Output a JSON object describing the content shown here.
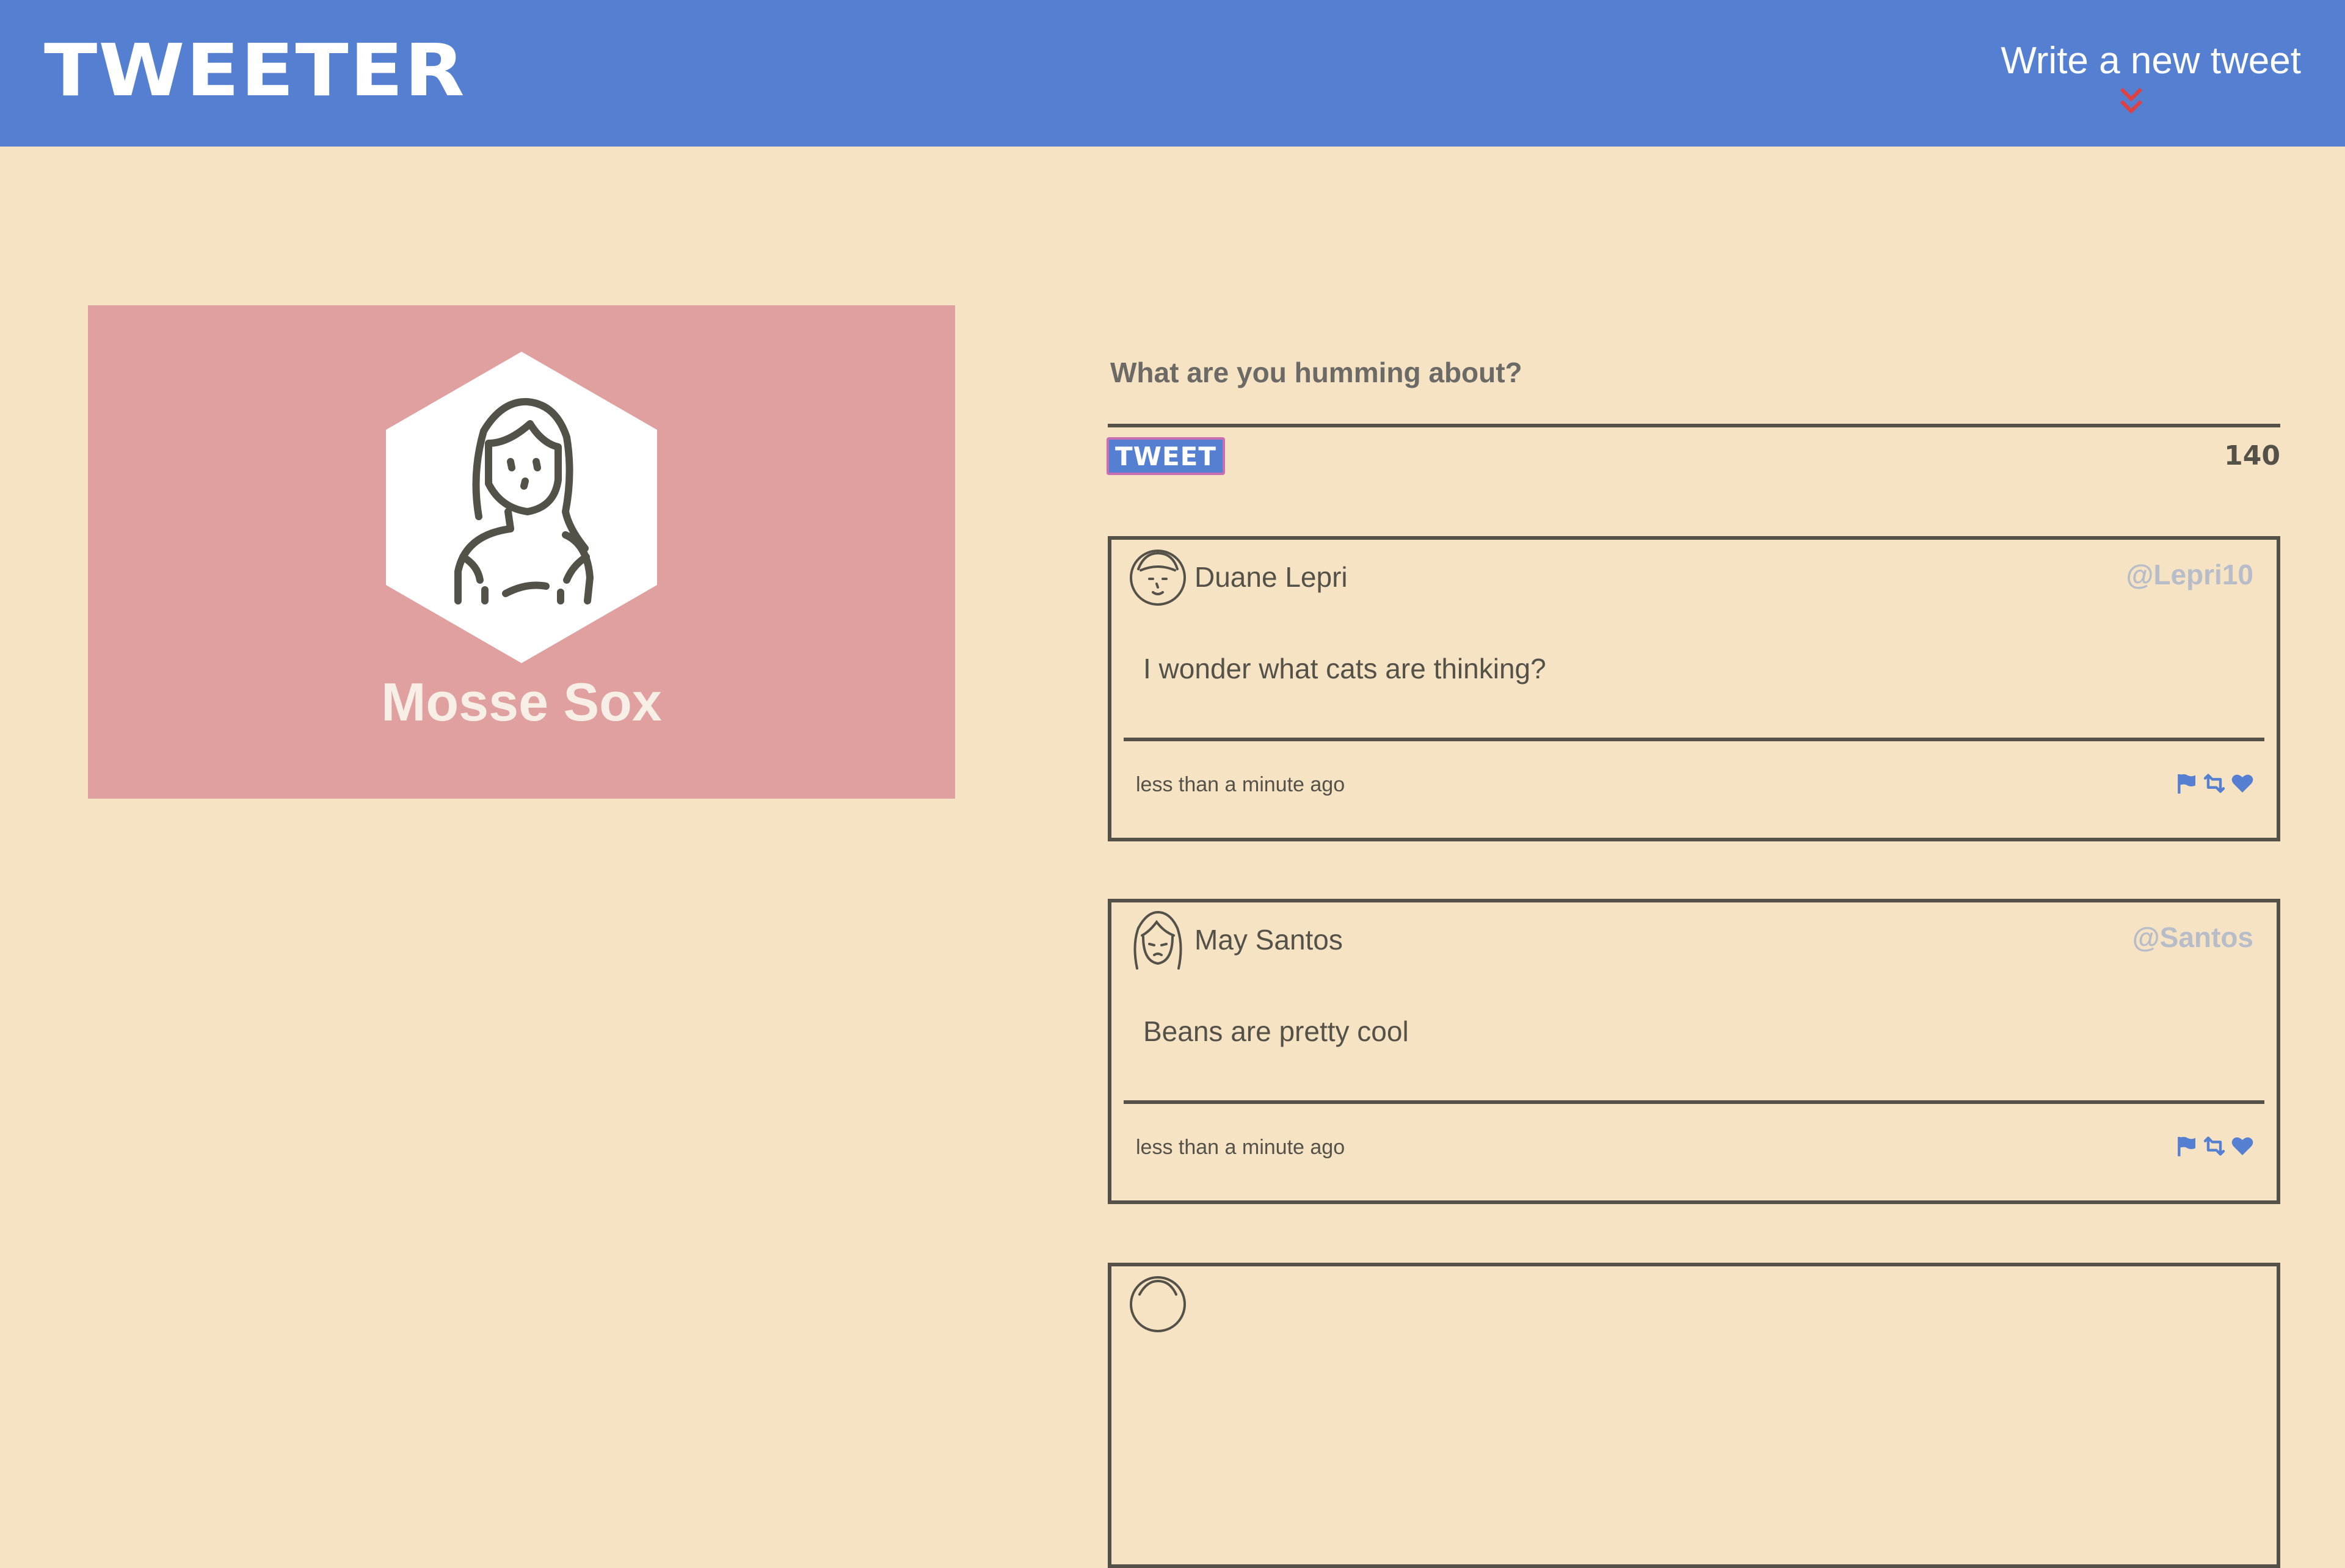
{
  "nav": {
    "brand": "TWEETER",
    "compose_toggle": "Write a new tweet",
    "compose_arrow_icon": "double-chevron-down-icon",
    "background": "#5580d1",
    "arrow_color": "#e04040"
  },
  "profile": {
    "name": "Mosse Sox",
    "avatar_icon": "woman-avatar-icon",
    "background": "#e0a0a0"
  },
  "composer": {
    "placeholder": "What are you humming about?",
    "submit_label": "TWEET",
    "char_counter": "140"
  },
  "tweets": [
    {
      "name": "Duane Lepri",
      "handle": "@Lepri10",
      "content": "I wonder what cats are thinking?",
      "time": "less than a minute ago",
      "avatar_icon": "man-avatar-icon",
      "actions": [
        "flag-icon",
        "retweet-icon",
        "heart-icon"
      ]
    },
    {
      "name": "May Santos",
      "handle": "@Santos",
      "content": "Beans are pretty cool",
      "time": "less than a minute ago",
      "avatar_icon": "woman-avatar-icon",
      "actions": [
        "flag-icon",
        "retweet-icon",
        "heart-icon"
      ]
    },
    {
      "name": "",
      "handle": "",
      "content": "",
      "time": "",
      "avatar_icon": "avatar-icon",
      "actions": []
    }
  ],
  "colors": {
    "page_background": "#f5e3c3",
    "ink": "#545149",
    "handle": "#b7bcc9",
    "action_icons": "#5580d1"
  }
}
